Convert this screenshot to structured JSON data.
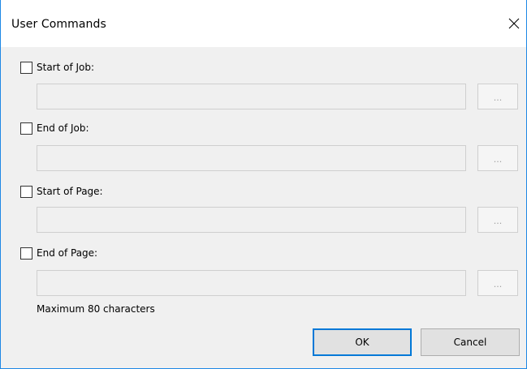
{
  "window": {
    "title": "User Commands",
    "close_glyph": "close-icon"
  },
  "commands": [
    {
      "label": "Start of Job:",
      "value": "",
      "checked": false,
      "browse_label": "..."
    },
    {
      "label": "End of Job:",
      "value": "",
      "checked": false,
      "browse_label": "..."
    },
    {
      "label": "Start of Page:",
      "value": "",
      "checked": false,
      "browse_label": "..."
    },
    {
      "label": "End of Page:",
      "value": "",
      "checked": false,
      "browse_label": "..."
    }
  ],
  "note": "Maximum 80 characters",
  "buttons": {
    "ok": "OK",
    "cancel": "Cancel"
  },
  "colors": {
    "accent": "#0078d7",
    "window_border": "#1e88e5",
    "dialog_bg": "#f0f0f0"
  }
}
